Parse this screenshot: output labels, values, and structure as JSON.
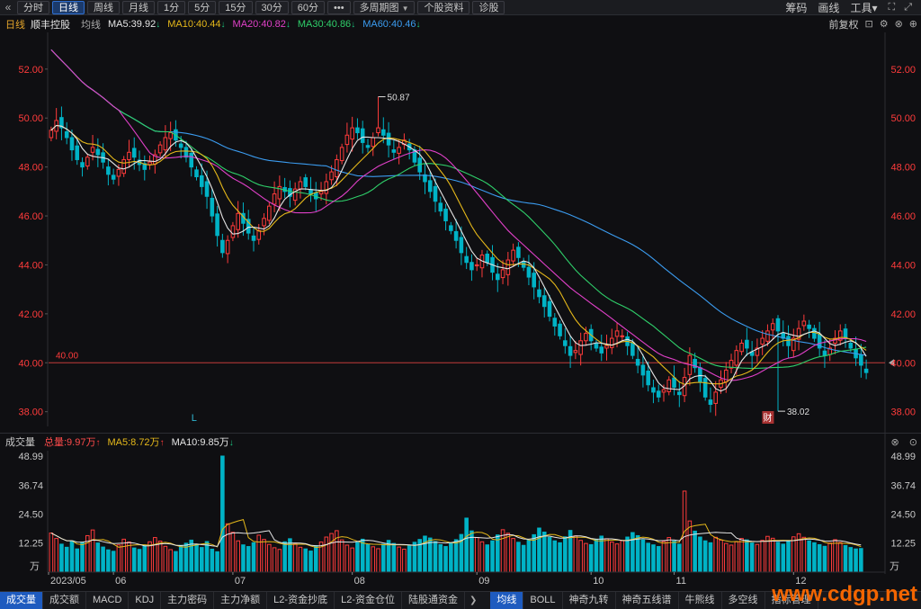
{
  "toolbar": {
    "back_glyph": "«",
    "periods": [
      "分时",
      "日线",
      "周线",
      "月线",
      "1分",
      "5分",
      "15分",
      "30分",
      "60分"
    ],
    "active_period": "日线",
    "more_label": "•••",
    "multi_period_label": "多周期图",
    "profile_label": "个股资料",
    "diagnose_label": "诊股",
    "right_items": [
      "筹码",
      "画线",
      "工具"
    ],
    "tools_chevron": "▾",
    "fullscreen_glyph": "⛶",
    "expand_glyph": "⤢"
  },
  "infobar": {
    "period": "日线",
    "stock_name": "顺丰控股",
    "avg_label": "均线",
    "ma": [
      {
        "label": "MA5:39.92",
        "dir": "down",
        "color": "#e6e6e6"
      },
      {
        "label": "MA10:40.44",
        "dir": "down",
        "color": "#e5b81a"
      },
      {
        "label": "MA20:40.82",
        "dir": "down",
        "color": "#e040c8"
      },
      {
        "label": "MA30:40.86",
        "dir": "down",
        "color": "#2fcf6a"
      },
      {
        "label": "MA60:40.46",
        "dir": "down",
        "color": "#3b9cf0"
      }
    ],
    "adjust_label": "前复权",
    "lock_glyph": "🔒",
    "settings_glyph": "⚙",
    "close_glyph": "✕",
    "add_glyph": "+"
  },
  "volume": {
    "title": "成交量",
    "total": "总量:9.97万",
    "ma5": "MA5:8.72万",
    "ma10": "MA10:9.85万",
    "close_glyph": "✕",
    "collapse_glyph": "⌃"
  },
  "bottom_tabs": {
    "left": [
      "成交量",
      "成交额",
      "MACD",
      "KDJ",
      "主力密码",
      "主力净额",
      "L2-资金抄底",
      "L2-资金仓位",
      "陆股通资金"
    ],
    "left_active": "成交量",
    "more_glyph": "❯",
    "right": [
      "均线",
      "BOLL",
      "神奇九转",
      "神奇五线谱",
      "牛熊线",
      "多空线",
      "指标管理"
    ],
    "right_active": "均线"
  },
  "watermark": "www.cdgp.net",
  "colors": {
    "up": "#ff3b3b",
    "down": "#00b3c6",
    "ma5": "#e6e6e6",
    "ma10": "#e5b81a",
    "ma20": "#e040c8",
    "ma30": "#2fcf6a",
    "ma60": "#3b9cf0",
    "ref_line": "#c23b3b",
    "price_axis": "#ff3b3b",
    "vol_axis": "#c8c8c8"
  },
  "chart_data": {
    "type": "candlestick",
    "price_ticks": [
      "52.00",
      "50.00",
      "48.00",
      "46.00",
      "44.00",
      "42.00",
      "40.00",
      "38.00"
    ],
    "price_range": [
      37.4,
      53.5
    ],
    "ref_price": 40.0,
    "ref_label": "40.00",
    "max_label": "50.87",
    "max_value": 50.87,
    "max_index": 63,
    "min_label": "38.02",
    "min_value": 38.02,
    "min_index": 140,
    "marker_L": "L",
    "marker_L_index": 27,
    "marker_fin": "财",
    "marker_fin_index": 138,
    "x_labels": [
      {
        "label": "2023/05",
        "index": 0
      },
      {
        "label": "06",
        "index": 12
      },
      {
        "label": "07",
        "index": 35
      },
      {
        "label": "08",
        "index": 58
      },
      {
        "label": "09",
        "index": 82
      },
      {
        "label": "10",
        "index": 104
      },
      {
        "label": "11",
        "index": 120
      },
      {
        "label": "12",
        "index": 143
      }
    ],
    "vol_ticks": [
      "48.99",
      "36.74",
      "24.50",
      "12.25"
    ],
    "vol_unit": "万",
    "vol_range": [
      0,
      48.99
    ],
    "closes": [
      49.5,
      49.9,
      49.6,
      49.2,
      48.7,
      48.3,
      48.0,
      48.4,
      48.8,
      48.5,
      48.2,
      47.7,
      47.5,
      47.9,
      48.3,
      48.6,
      48.4,
      48.1,
      47.9,
      48.2,
      48.5,
      48.9,
      49.2,
      49.4,
      49.1,
      48.8,
      48.4,
      48.0,
      47.6,
      47.2,
      46.8,
      46.0,
      45.2,
      44.5,
      45.0,
      45.6,
      46.1,
      45.7,
      45.3,
      45.0,
      45.4,
      45.9,
      46.4,
      46.9,
      47.2,
      47.0,
      46.8,
      47.1,
      47.4,
      47.2,
      46.9,
      46.7,
      47.0,
      47.4,
      47.8,
      48.3,
      48.8,
      49.3,
      49.6,
      49.4,
      49.0,
      48.8,
      49.2,
      49.6,
      49.3,
      48.9,
      48.6,
      48.8,
      49.1,
      48.7,
      48.2,
      47.8,
      47.4,
      47.0,
      46.6,
      46.2,
      45.8,
      45.4,
      45.0,
      44.5,
      44.1,
      43.8,
      44.0,
      44.4,
      44.1,
      43.7,
      43.4,
      43.8,
      44.2,
      44.6,
      44.3,
      43.9,
      43.5,
      43.1,
      42.7,
      42.3,
      41.9,
      41.5,
      41.1,
      40.7,
      40.3,
      40.5,
      40.9,
      41.2,
      40.9,
      40.6,
      40.4,
      40.7,
      41.0,
      41.3,
      41.1,
      40.7,
      40.3,
      39.9,
      39.5,
      39.1,
      38.8,
      38.6,
      38.9,
      39.3,
      39.0,
      38.7,
      39.4,
      40.3,
      39.8,
      39.2,
      38.6,
      38.3,
      38.8,
      39.3,
      39.7,
      40.1,
      40.5,
      40.8,
      40.6,
      40.3,
      40.6,
      41.0,
      41.3,
      41.6,
      41.3,
      41.0,
      40.7,
      41.0,
      41.4,
      41.7,
      41.4,
      41.0,
      40.6,
      40.3,
      40.6,
      41.0,
      41.3,
      41.0,
      40.6,
      40.2,
      39.9,
      39.6
    ],
    "volumes": [
      16.5,
      14.2,
      11.8,
      10.5,
      13.2,
      9.8,
      12.6,
      15.4,
      17.8,
      12.3,
      10.6,
      9.4,
      8.8,
      11.5,
      13.9,
      12.7,
      10.2,
      9.6,
      11.4,
      12.8,
      14.6,
      13.1,
      10.9,
      9.5,
      8.7,
      11.3,
      12.2,
      13.5,
      11.8,
      10.4,
      12.9,
      9.7,
      8.6,
      48.99,
      20.4,
      16.8,
      13.2,
      11.5,
      10.8,
      12.4,
      15.6,
      13.8,
      11.7,
      10.3,
      9.6,
      12.8,
      14.1,
      11.9,
      10.5,
      9.8,
      8.9,
      11.2,
      12.7,
      14.8,
      16.3,
      17.5,
      13.6,
      11.4,
      10.2,
      12.5,
      13.9,
      11.6,
      10.7,
      9.9,
      11.8,
      13.4,
      12.1,
      10.6,
      9.7,
      11.3,
      12.6,
      13.8,
      15.2,
      14.4,
      12.9,
      11.6,
      10.8,
      12.3,
      13.7,
      15.9,
      22.8,
      17.4,
      14.6,
      12.8,
      11.5,
      13.2,
      15.7,
      17.9,
      16.4,
      14.2,
      12.6,
      11.3,
      13.5,
      15.8,
      18.6,
      16.9,
      14.7,
      13.2,
      12.4,
      14.9,
      17.6,
      15.3,
      13.4,
      12.1,
      11.6,
      13.8,
      15.2,
      14.1,
      12.7,
      11.9,
      13.3,
      14.8,
      16.7,
      15.4,
      13.6,
      12.2,
      11.5,
      10.8,
      12.9,
      14.6,
      13.1,
      11.8,
      34.2,
      21.6,
      17.3,
      14.8,
      13.2,
      12.4,
      14.7,
      13.5,
      12.1,
      11.4,
      12.8,
      14.2,
      13.6,
      12.3,
      11.7,
      13.4,
      15.1,
      14.3,
      12.6,
      11.8,
      13.1,
      14.9,
      16.2,
      14.7,
      13.2,
      12.4,
      11.6,
      10.9,
      12.3,
      13.7,
      12.5,
      11.2,
      10.4,
      9.8,
      9.97
    ]
  }
}
